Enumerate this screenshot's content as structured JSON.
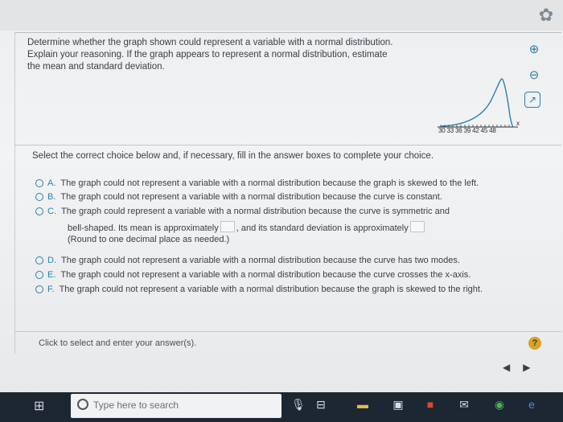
{
  "question": {
    "text": "Determine whether the graph shown could represent a variable with a normal distribution. Explain your reasoning. If the graph appears to represent a normal distribution, estimate the mean and standard deviation."
  },
  "graph": {
    "x_ticks": "30 33 36 39 42 45 48",
    "axis_end_label": "x"
  },
  "instruction": "Select the correct choice below and, if necessary, fill in the answer boxes to complete your choice.",
  "choices": [
    {
      "letter": "A.",
      "text": "The graph could not represent a variable with a normal distribution because the graph is skewed to the left."
    },
    {
      "letter": "B.",
      "text": "The graph could not represent a variable with a normal distribution because the curve is constant."
    },
    {
      "letter": "C.",
      "text": "The graph could represent a variable with a normal distribution because the curve is symmetric and",
      "line2a": "bell-shaped. Its mean is approximately",
      "line2b": ", and its standard deviation is approximately",
      "note": "(Round to one decimal place as needed.)"
    },
    {
      "letter": "D.",
      "text": "The graph could not represent a variable with a normal distribution because the curve has two modes."
    },
    {
      "letter": "E.",
      "text": "The graph could not represent a variable with a normal distribution because the curve crosses the x-axis."
    },
    {
      "letter": "F.",
      "text": "The graph could not represent a variable with a normal distribution because the graph is skewed to the right."
    }
  ],
  "footer": {
    "status": "Click to select and enter your answer(s).",
    "help": "?",
    "prev": "◀",
    "next": "▶"
  },
  "taskbar": {
    "search_placeholder": "Type here to search"
  },
  "icons": {
    "gear": "gear-icon",
    "zoom_in": "zoom-in-icon",
    "zoom_out": "zoom-out-icon",
    "popout": "popout-icon"
  },
  "colors": {
    "accent": "#2d7fa8",
    "help": "#d6a32a",
    "taskbar": "#1d2633"
  }
}
